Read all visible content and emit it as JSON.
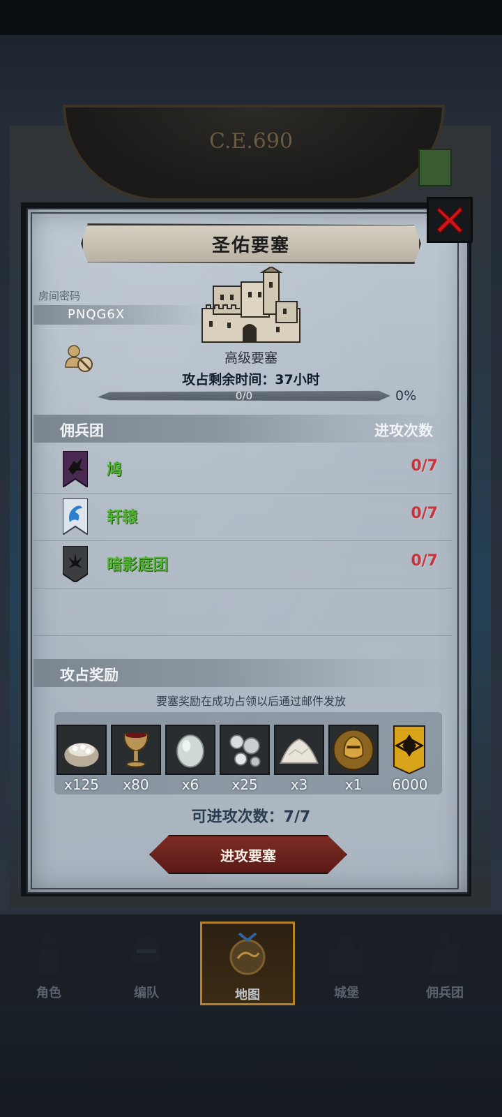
{
  "background": {
    "year": "C.E.690"
  },
  "dialog": {
    "title": "圣佑要塞",
    "room_label": "房间密码",
    "room_code": "PNQG6X",
    "fort_type": "高级要塞",
    "time_label": "攻占剩余时间：",
    "time_value": "37小时",
    "progress_text": "0/0",
    "progress_pct": "0%",
    "progress_fraction": 0,
    "merc_section": {
      "title": "佣兵团",
      "right": "进攻次数"
    },
    "mercenaries": [
      {
        "name": "鸠",
        "count": "0/7",
        "banner_color": "#4a2a52",
        "icon": "raven-banner-icon"
      },
      {
        "name": "轩辕",
        "count": "0/7",
        "banner_color": "#dde4ec",
        "icon": "dragon-banner-icon"
      },
      {
        "name": "暗影庭团",
        "count": "0/7",
        "banner_color": "#3b3d40",
        "icon": "shadow-banner-icon"
      }
    ],
    "reward_section": {
      "title": "攻占奖励"
    },
    "reward_note": "要塞奖励在成功占领以后通过邮件发放",
    "rewards": [
      {
        "icon": "flour-sack-icon",
        "qty": "x125"
      },
      {
        "icon": "goblet-icon",
        "qty": "x80"
      },
      {
        "icon": "gem-egg-icon",
        "qty": "x6"
      },
      {
        "icon": "silver-ore-icon",
        "qty": "x25"
      },
      {
        "icon": "salt-pile-icon",
        "qty": "x3"
      },
      {
        "icon": "knight-helmet-icon",
        "qty": "x1"
      },
      {
        "icon": "rank-badge-icon",
        "qty": "6000"
      }
    ],
    "attack_left_label": "可进攻次数：7/7",
    "attack_button": "进攻要塞"
  },
  "tabs": [
    {
      "label": "角色",
      "icon": "knight-icon",
      "active": false
    },
    {
      "label": "编队",
      "icon": "helmet-icon",
      "active": false
    },
    {
      "label": "地图",
      "icon": "map-dragon-icon",
      "active": true
    },
    {
      "label": "城堡",
      "icon": "castle-icon",
      "active": false
    },
    {
      "label": "佣兵团",
      "icon": "horse-knight-icon",
      "active": false
    }
  ],
  "colors": {
    "accent_green": "#52b632",
    "count_red": "#c9343a",
    "button_red": "#6e2520",
    "active_tab": "#b88326"
  }
}
